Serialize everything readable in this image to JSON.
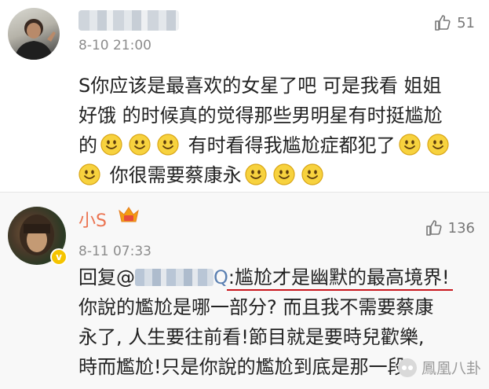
{
  "comments": [
    {
      "username": "",
      "time": "8-10 21:00",
      "likes": "51",
      "lines": [
        "S你应该是最喜欢的女星了吧 可是我看 姐姐",
        "好饿 的时候真的觉得那些男明星有时挺尴尬",
        "有时看得我尴尬症都犯了",
        "你很需要蔡康永"
      ],
      "line3_prefix": "的",
      "icons": {
        "like": "thumbs-up-icon",
        "emoji": "smile-emoji-icon"
      }
    },
    {
      "username": "小S",
      "time": "8-11 07:33",
      "likes": "136",
      "reply_prefix": "回复@",
      "mention_end": "Q",
      "highlight": ":尴尬才是幽默的最高境界!",
      "lines": [
        "你說的尷尬是哪一部分? 而且我不需要蔡康",
        "永了, 人生要往前看!節目就是要時兒歡樂,",
        "時而尷尬!只是你說的尷尬到底是那一段"
      ],
      "icons": {
        "like": "thumbs-up-icon",
        "badge": "verified-v-badge",
        "vip": "vip-badge-icon"
      },
      "colors": {
        "username": "#eb7350",
        "highlight_underline": "#c8161d"
      }
    }
  ],
  "watermark": "鳳凰八卦"
}
